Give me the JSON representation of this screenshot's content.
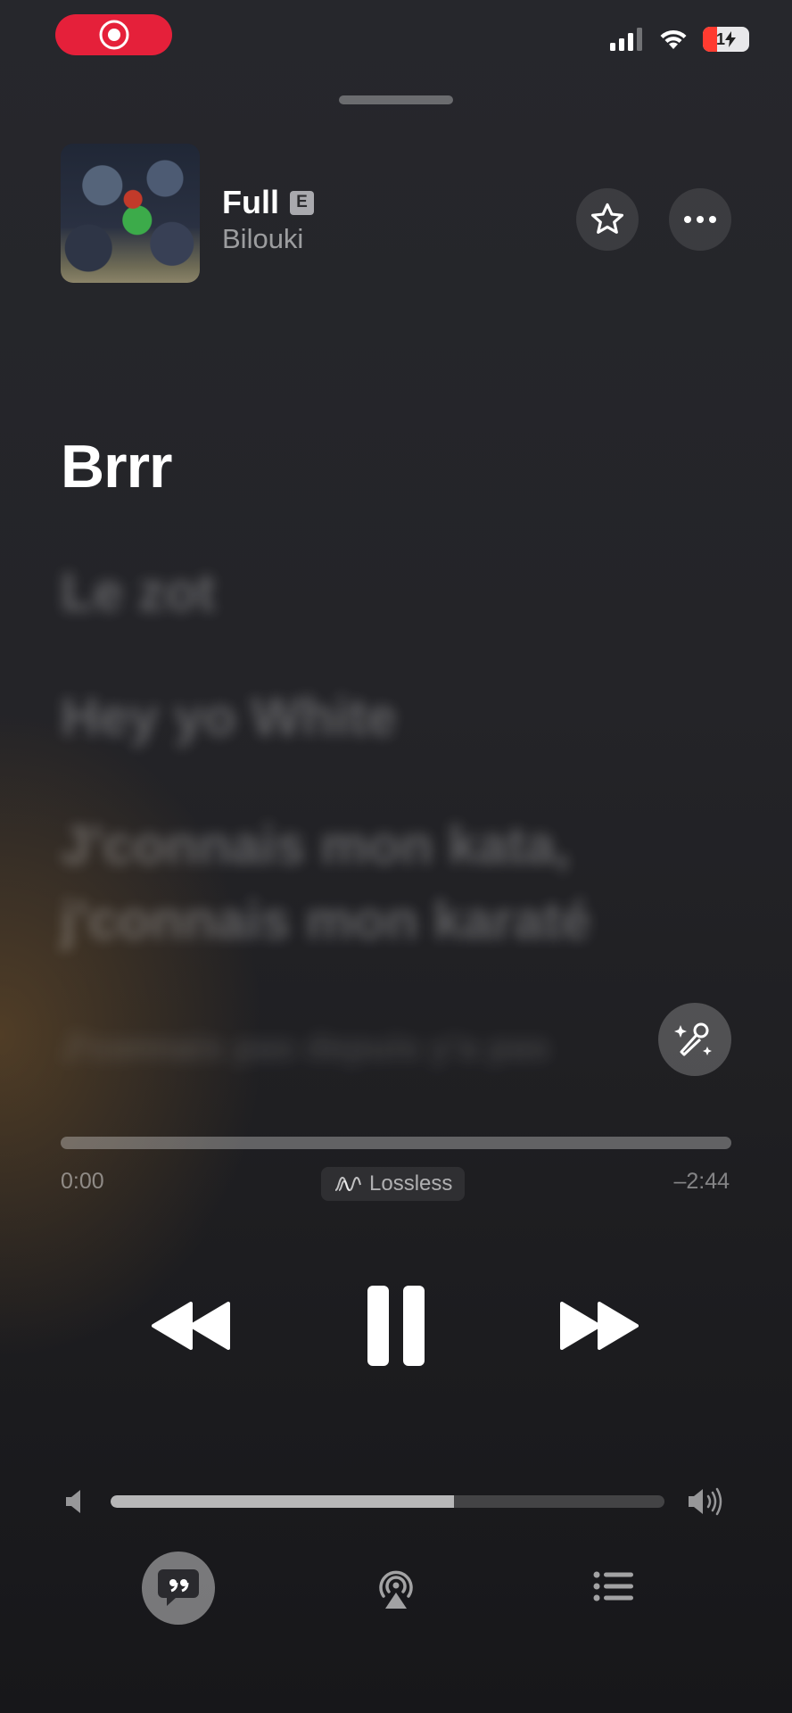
{
  "status_bar": {
    "recording_indicator_icon": "record-icon",
    "cellular_icon": "cellular-signal-icon",
    "wifi_icon": "wifi-icon",
    "battery_level_label": "1",
    "battery_charging_icon": "bolt-icon"
  },
  "now_playing": {
    "title": "Full",
    "explicit_badge": "E",
    "artist": "Bilouki",
    "favorite_icon": "star-icon",
    "more_icon": "ellipsis-icon"
  },
  "lyrics": {
    "current_line": "Brrr",
    "upcoming_lines": [
      "Le zot",
      "Hey yo White",
      "J'connais mon kata,",
      "j'connais mon karaté",
      "J'connais pas depuis y'a pas"
    ]
  },
  "sing_button_icon": "microphone-sparkles-icon",
  "playback": {
    "elapsed": "0:00",
    "remaining": "–2:44",
    "progress": 0.0,
    "quality_label": "Lossless",
    "quality_icon": "lossless-wave-icon"
  },
  "transport": {
    "previous_icon": "rewind-icon",
    "play_pause_icon": "pause-icon",
    "next_icon": "fast-forward-icon"
  },
  "volume": {
    "level": 0.62,
    "min_icon": "speaker-low-icon",
    "max_icon": "speaker-high-icon"
  },
  "bottom_bar": {
    "lyrics_icon": "lyrics-quote-bubble-icon",
    "airplay_icon": "airplay-audio-icon",
    "queue_icon": "queue-list-icon"
  },
  "colors": {
    "recording_red": "#e5203a",
    "battery_red": "#ff3b30"
  }
}
